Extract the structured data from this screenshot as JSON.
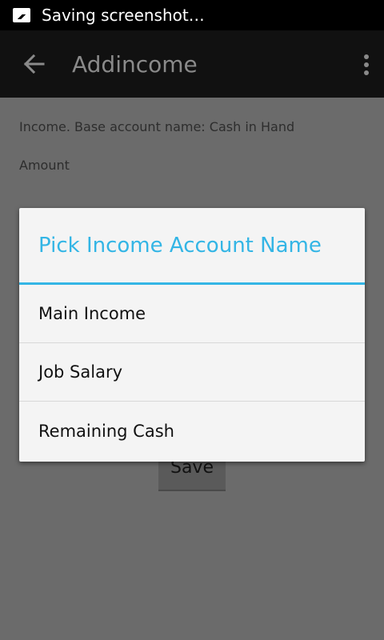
{
  "status_bar": {
    "icon": "image-icon",
    "text": "Saving screenshot…"
  },
  "action_bar": {
    "title": "Addincome",
    "back_icon": "back-arrow-icon",
    "menu_icon": "overflow-menu-icon"
  },
  "form": {
    "income_label": "Income. Base account name: Cash in Hand",
    "amount_label": "Amount",
    "save_label": "Save"
  },
  "dialog": {
    "title": "Pick Income Account Name",
    "items": [
      {
        "label": "Main Income"
      },
      {
        "label": "Job Salary"
      },
      {
        "label": "Remaining Cash"
      }
    ],
    "accent_color": "#33b5e5"
  }
}
